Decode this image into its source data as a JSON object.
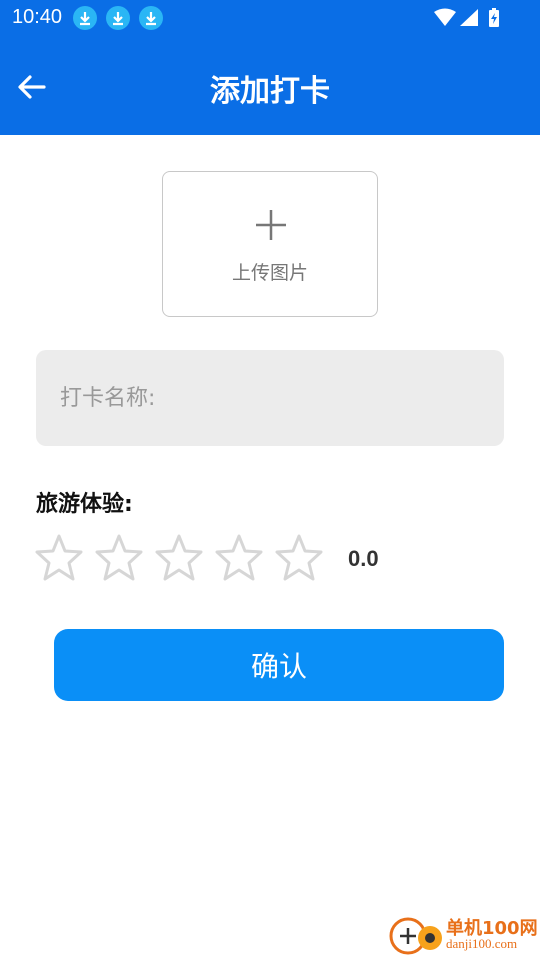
{
  "status_bar": {
    "time": "10:40",
    "notifications": [
      "download-icon",
      "download-icon",
      "download-icon"
    ],
    "system_icons": [
      "wifi-icon",
      "signal-icon",
      "battery-icon"
    ]
  },
  "app_bar": {
    "title": "添加打卡",
    "back_icon": "arrow-left-icon",
    "color": "#0a6ee6"
  },
  "upload": {
    "icon": "plus-icon",
    "label": "上传图片"
  },
  "name_input": {
    "placeholder": "打卡名称:",
    "value": ""
  },
  "rating": {
    "label": "旅游体验:",
    "max_stars": 5,
    "value": 0,
    "display": "0.0"
  },
  "confirm_button": {
    "label": "确认",
    "color": "#0a8ff7"
  },
  "watermark": {
    "brand": "单机100网",
    "url": "danji100.com"
  }
}
